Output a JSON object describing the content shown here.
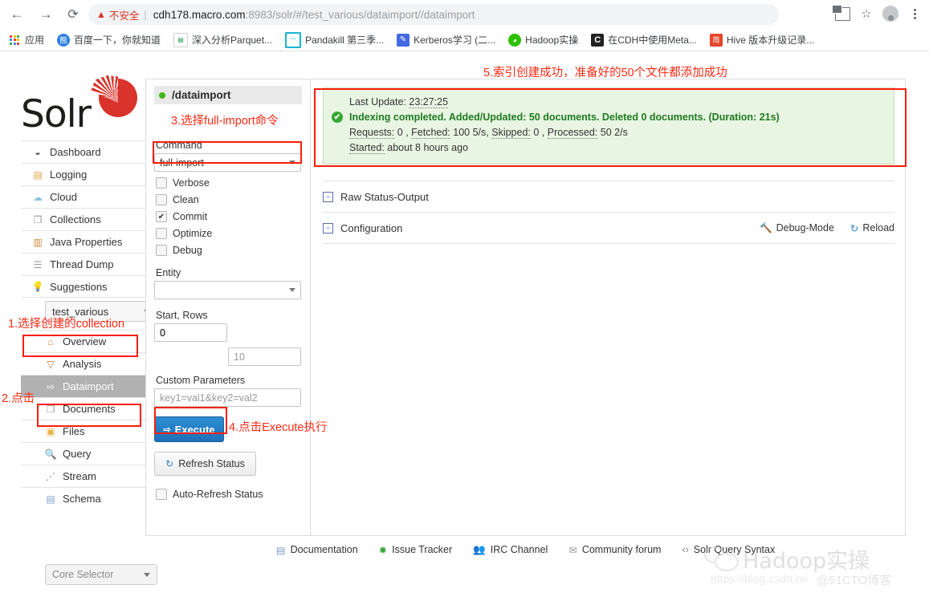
{
  "browser": {
    "back_icon": "back-arrow-icon",
    "forward_icon": "forward-arrow-icon",
    "reload_icon": "reload-icon",
    "security_warning": "不安全",
    "url_host": "cdh178.macro.com",
    "url_path": ":8983/solr/#/test_various/dataimport//dataimport",
    "url_full": "cdh178.macro.com:8983/solr/#/test_various/dataimport//dataimport",
    "translate_title": "translate-icon",
    "bookmark_star": "☆",
    "menu_icon": "kebab-menu-icon",
    "bookmarks": [
      {
        "label": "应用",
        "icon": "apps-grid-icon",
        "icon_color": "#4285f4"
      },
      {
        "label": "百度一下，你就知道",
        "icon": "baidu-icon",
        "icon_color": "#2b7fe0"
      },
      {
        "label": "深入分析Parquet...",
        "icon": "article-icon",
        "icon_color": "#1a9c5b"
      },
      {
        "label": "Pandakill 第三季...",
        "icon": "panda-icon",
        "icon_color": "#16b3d6"
      },
      {
        "label": "Kerberos学习 (二...",
        "icon": "feather-icon",
        "icon_color": "#4169e1"
      },
      {
        "label": "Hadoop实操",
        "icon": "wechat-icon",
        "icon_color": "#2dc100"
      },
      {
        "label": "在CDH中使用Meta...",
        "icon": "letter-c-icon",
        "icon_color": "#222222"
      },
      {
        "label": "Hive 版本升级记录...",
        "icon": "jian-icon",
        "icon_color": "#e8452b"
      }
    ]
  },
  "solr": {
    "logo_text": "Solr",
    "nav_items": [
      {
        "label": "Dashboard",
        "icon": "dashboard-icon"
      },
      {
        "label": "Logging",
        "icon": "logging-icon"
      },
      {
        "label": "Cloud",
        "icon": "cloud-icon"
      },
      {
        "label": "Collections",
        "icon": "collections-icon"
      },
      {
        "label": "Java Properties",
        "icon": "java-properties-icon"
      },
      {
        "label": "Thread Dump",
        "icon": "thread-dump-icon"
      },
      {
        "label": "Suggestions",
        "icon": "suggestions-bulb-icon"
      }
    ],
    "collection_selected": "test_various",
    "sub_nav": [
      {
        "label": "Overview",
        "icon": "home-icon",
        "active": false
      },
      {
        "label": "Analysis",
        "icon": "funnel-icon",
        "active": false
      },
      {
        "label": "Dataimport",
        "icon": "dataimport-icon",
        "active": true
      },
      {
        "label": "Documents",
        "icon": "documents-icon",
        "active": false
      },
      {
        "label": "Files",
        "icon": "folder-icon",
        "active": false
      },
      {
        "label": "Query",
        "icon": "magnifier-icon",
        "active": false
      },
      {
        "label": "Stream",
        "icon": "stream-icon",
        "active": false
      },
      {
        "label": "Schema",
        "icon": "schema-book-icon",
        "active": false
      }
    ],
    "core_selector_placeholder": "Core Selector"
  },
  "dataimport": {
    "handler_name": "/dataimport",
    "command_label": "Command",
    "command_value": "full-import",
    "checkboxes": [
      {
        "label": "Verbose",
        "checked": false
      },
      {
        "label": "Clean",
        "checked": false
      },
      {
        "label": "Commit",
        "checked": true
      },
      {
        "label": "Optimize",
        "checked": false
      },
      {
        "label": "Debug",
        "checked": false
      }
    ],
    "entity_label": "Entity",
    "entity_value": "",
    "start_rows_label": "Start, Rows",
    "start_value": "0",
    "rows_placeholder": "10",
    "custom_params_label": "Custom Parameters",
    "custom_params_placeholder": "key1=val1&key2=val2",
    "execute_label": "Execute",
    "refresh_label": "Refresh Status",
    "auto_refresh_label": "Auto-Refresh Status",
    "auto_refresh_checked": false
  },
  "status": {
    "last_update_label": "Last Update:",
    "last_update_value": "23:27:25",
    "message": "Indexing completed. Added/Updated: 50 documents. Deleted 0 documents. (Duration: 21s)",
    "requests_label": "Requests:",
    "requests_value": "0",
    "fetched_label": "Fetched:",
    "fetched_value": "100 5/s,",
    "skipped_label": "Skipped:",
    "skipped_value": "0",
    "processed_label": "Processed:",
    "processed_value": "50 2/s",
    "started_label": "Started:",
    "started_value": "about 8 hours ago",
    "check_icon": "✔"
  },
  "accordions": [
    {
      "label": "Raw Status-Output",
      "actions": []
    },
    {
      "label": "Configuration",
      "actions": [
        {
          "label": "Debug-Mode",
          "icon": "hammer-icon"
        },
        {
          "label": "Reload",
          "icon": "reload-circle-icon"
        }
      ]
    }
  ],
  "footer": [
    {
      "label": "Documentation",
      "icon": "doc-icon"
    },
    {
      "label": "Issue Tracker",
      "icon": "bug-icon"
    },
    {
      "label": "IRC Channel",
      "icon": "people-icon"
    },
    {
      "label": "Community forum",
      "icon": "envelope-icon"
    },
    {
      "label": "Solr Query Syntax",
      "icon": "code-icon"
    }
  ],
  "annotations": {
    "step1": "1.选择创建的collection",
    "step2": "2.点击",
    "step3": "3.选择full-import命令",
    "step4": "4.点击Execute执行",
    "step5": "5.索引创建成功，准备好的50个文件都添加成功",
    "color": "#fc2b16"
  },
  "watermark": {
    "brand": "Hadoop实操",
    "blog_url": "https://blog.csdn.ne",
    "site": "@51CTO博客"
  }
}
